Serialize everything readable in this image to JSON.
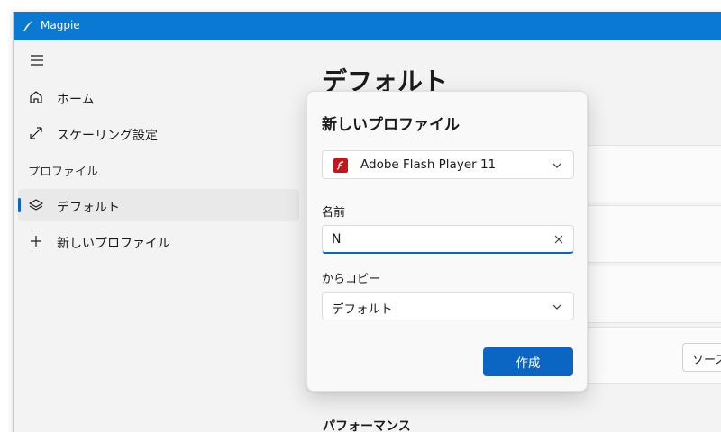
{
  "window": {
    "title": "Magpie",
    "accent": "#0a79d4"
  },
  "sidebar": {
    "toggle_icon": "hamburger-icon",
    "items": [
      {
        "label": "ホーム",
        "icon": "home-icon"
      },
      {
        "label": "スケーリング設定",
        "icon": "scale-arrows-icon"
      }
    ],
    "profiles_header": "プロファイル",
    "profiles": [
      {
        "label": "デフォルト",
        "icon": "layers-icon",
        "selected": true
      },
      {
        "label": "新しいプロファイル",
        "icon": "plus-icon"
      }
    ]
  },
  "main": {
    "title": "デフォルト",
    "card_button_label": "ソースウ",
    "section_title": "パフォーマンス"
  },
  "dialog": {
    "title": "新しいプロファイル",
    "app_select": {
      "value": "Adobe Flash Player 11",
      "icon": "flash-player-icon"
    },
    "name_label": "名前",
    "name_value": "N",
    "copy_from_label": "からコピー",
    "copy_from_value": "デフォルト",
    "create_label": "作成",
    "accent": "#0a66c2"
  }
}
